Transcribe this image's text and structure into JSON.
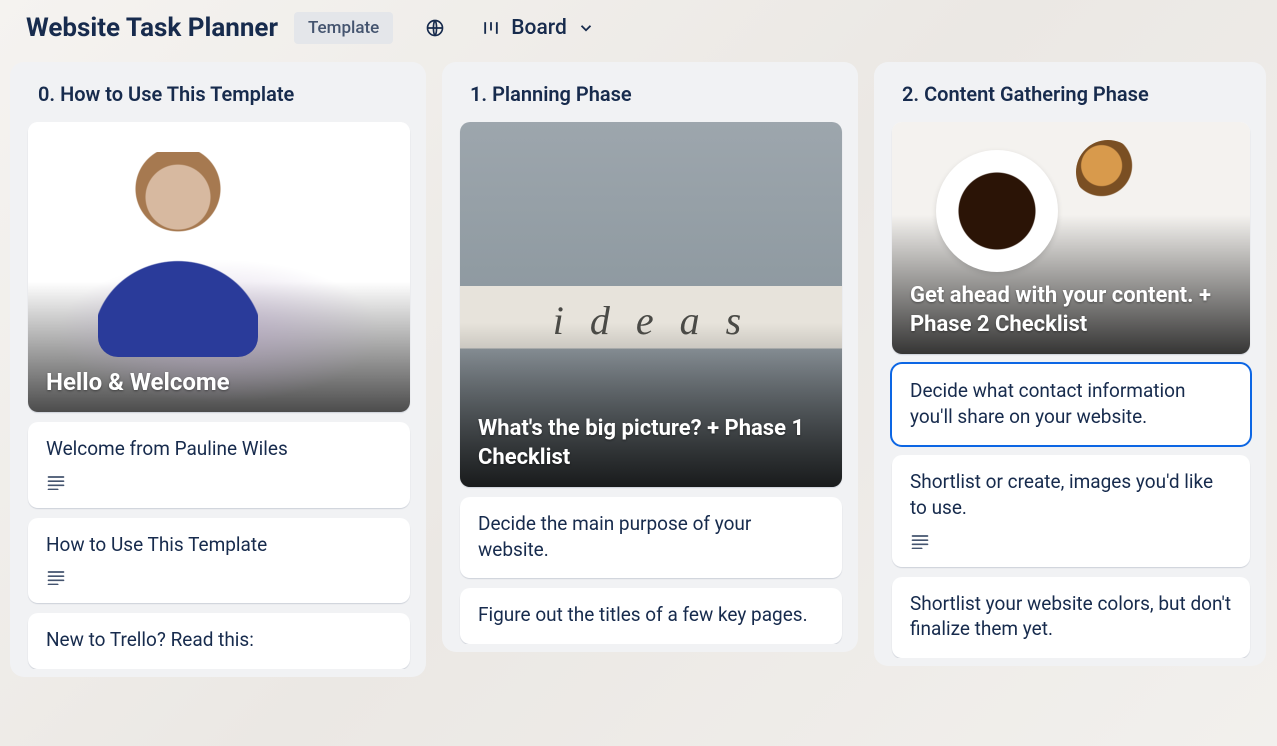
{
  "header": {
    "title": "Website Task Planner",
    "template_badge": "Template",
    "view_label": "Board"
  },
  "lists": [
    {
      "title": "0. How to Use This Template",
      "cover_card": {
        "title": "Hello & Welcome",
        "image": "person-welcome"
      },
      "cards": [
        {
          "text": "Welcome from Pauline Wiles",
          "has_description": true
        },
        {
          "text": "How to Use This Template",
          "has_description": true
        },
        {
          "text": "New to Trello? Read this:",
          "has_description": false
        }
      ]
    },
    {
      "title": "1. Planning Phase",
      "cover_card": {
        "title": "What's the big picture? + Phase 1 Checklist",
        "image": "ideas-pavement",
        "ideas_word": "ideas"
      },
      "cards": [
        {
          "text": "Decide the main purpose of your website.",
          "has_description": false
        },
        {
          "text": "Figure out the titles of a few key pages.",
          "has_description": false
        }
      ]
    },
    {
      "title": "2. Content Gathering Phase",
      "cover_card": {
        "title": "Get ahead with your content. + Phase 2 Checklist",
        "image": "coffee-desk"
      },
      "cards": [
        {
          "text": "Decide what contact information you'll share on your website.",
          "has_description": false,
          "selected": true
        },
        {
          "text": "Shortlist or create, images you'd like to use.",
          "has_description": true
        },
        {
          "text": "Shortlist your website colors, but don't finalize them yet.",
          "has_description": false
        }
      ]
    }
  ]
}
